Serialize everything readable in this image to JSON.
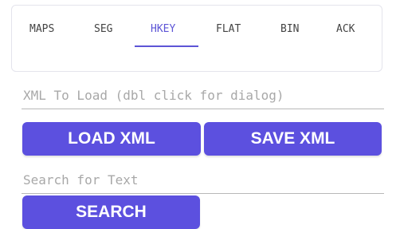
{
  "tabs": [
    {
      "label": "MAPS",
      "active": false
    },
    {
      "label": "SEG",
      "active": false
    },
    {
      "label": "HKEY",
      "active": true
    },
    {
      "label": "FLAT",
      "active": false
    },
    {
      "label": "BIN",
      "active": false
    },
    {
      "label": "ACK",
      "active": false
    }
  ],
  "xml_input": {
    "value": "",
    "placeholder": "XML To Load (dbl click for dialog)"
  },
  "buttons": {
    "load_label": "LOAD XML",
    "save_label": "SAVE XML",
    "search_label": "SEARCH"
  },
  "search_input": {
    "value": "",
    "placeholder": "Search for Text"
  },
  "colors": {
    "accent": "#5c50df",
    "active_tab": "#5d55d6"
  }
}
